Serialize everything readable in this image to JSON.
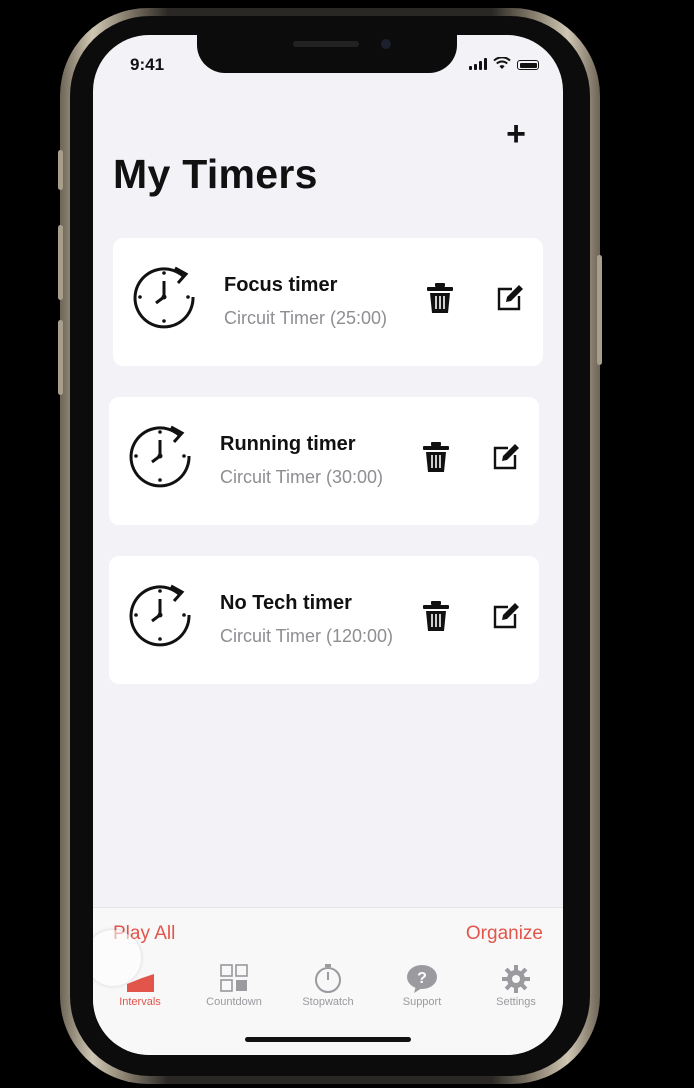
{
  "status_bar": {
    "time": "9:41"
  },
  "header": {
    "add_label": "+",
    "title": "My Timers"
  },
  "timers": [
    {
      "name": "Focus timer",
      "description": "Circuit Timer (25:00)"
    },
    {
      "name": "Running timer",
      "description": "Circuit Timer (30:00)"
    },
    {
      "name": "No Tech timer",
      "description": "Circuit Timer (120:00)"
    }
  ],
  "toolbar": {
    "play_all_label": "Play All",
    "organize_label": "Organize"
  },
  "tabs": [
    {
      "label": "Intervals",
      "icon": "intervals-icon",
      "active": true
    },
    {
      "label": "Countdown",
      "icon": "countdown-icon",
      "active": false
    },
    {
      "label": "Stopwatch",
      "icon": "stopwatch-icon",
      "active": false
    },
    {
      "label": "Support",
      "icon": "support-icon",
      "active": false
    },
    {
      "label": "Settings",
      "icon": "settings-icon",
      "active": false
    }
  ],
  "colors": {
    "accent": "#e2554a",
    "background": "#f2f2f7",
    "card": "#ffffff",
    "muted": "#8e8e93"
  }
}
